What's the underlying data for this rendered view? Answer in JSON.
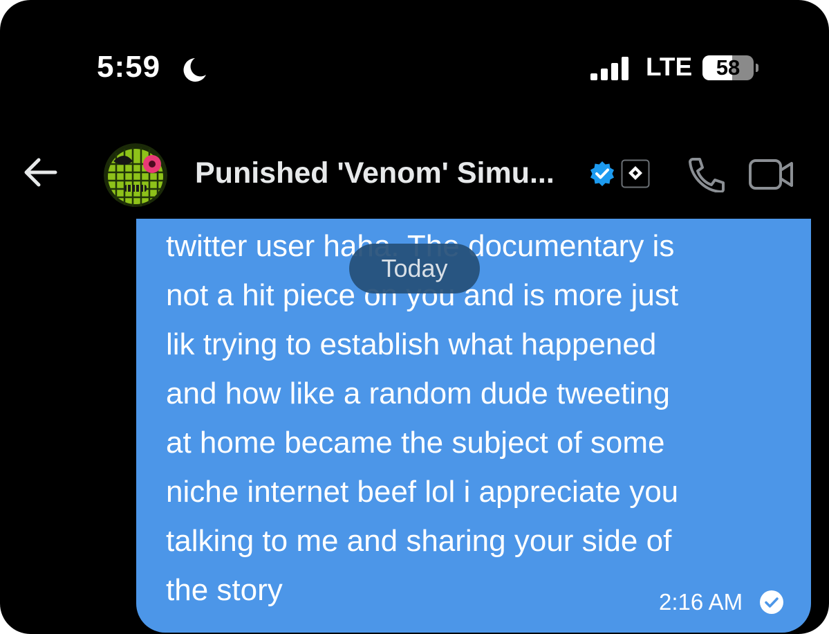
{
  "status_bar": {
    "time": "5:59",
    "network": "LTE",
    "battery": "58",
    "battery_level": 0.58
  },
  "header": {
    "contact_name": "Punished 'Venom' Simu...",
    "back_icon": "arrow-left-icon",
    "call_icon": "phone-icon",
    "video_icon": "video-camera-icon"
  },
  "date_separator": "Today",
  "message": {
    "lines": [
      "twitter user haha. The documentary is",
      "not a hit piece on you and is more just",
      "lik trying to establish what happened",
      "and how like a random dude tweeting",
      "at home became the subject of some",
      "niche internet beef lol i appreciate you",
      "talking to me and sharing your side of",
      "the story"
    ],
    "time": "2:16 AM",
    "status_icon": "read-check-icon"
  },
  "colors": {
    "background": "#000000",
    "bubble": "#4c96e8",
    "verified": "#1d9bf0",
    "icon_gray": "#8b8f94"
  }
}
